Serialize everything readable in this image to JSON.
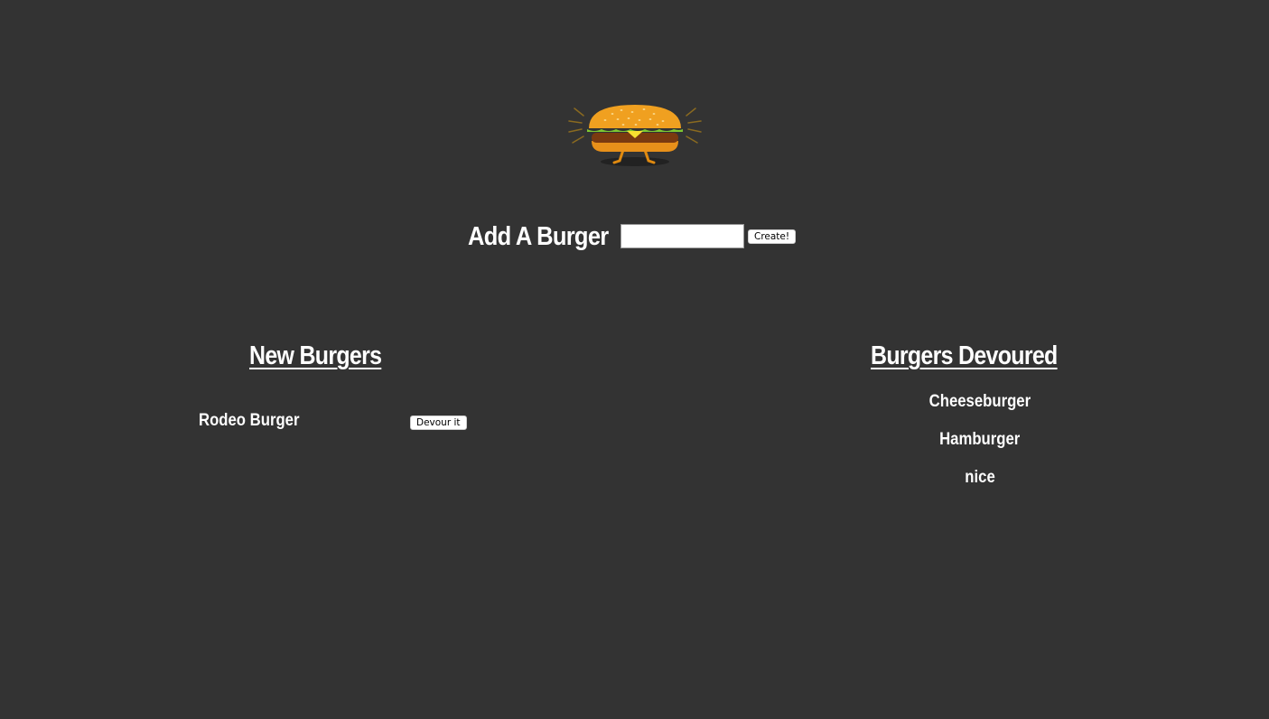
{
  "header": {
    "logo_icon": "burger-logo-icon"
  },
  "add_form": {
    "title": "Add A Burger",
    "input_value": "",
    "input_placeholder": "",
    "submit_label": "Create!"
  },
  "new_burgers": {
    "heading": "New Burgers",
    "items": [
      {
        "name": "Rodeo Burger",
        "button_label": "Devour it"
      }
    ]
  },
  "devoured_burgers": {
    "heading": "Burgers Devoured",
    "items": [
      {
        "name": "Cheeseburger"
      },
      {
        "name": "Hamburger"
      },
      {
        "name": "nice"
      }
    ]
  },
  "colors": {
    "background": "#333333",
    "text": "#ffffff",
    "button_bg": "#ffffff",
    "bun": "#f0a020",
    "patty": "#7a3a10",
    "lettuce": "#7ec832",
    "cheese": "#f8e030"
  }
}
